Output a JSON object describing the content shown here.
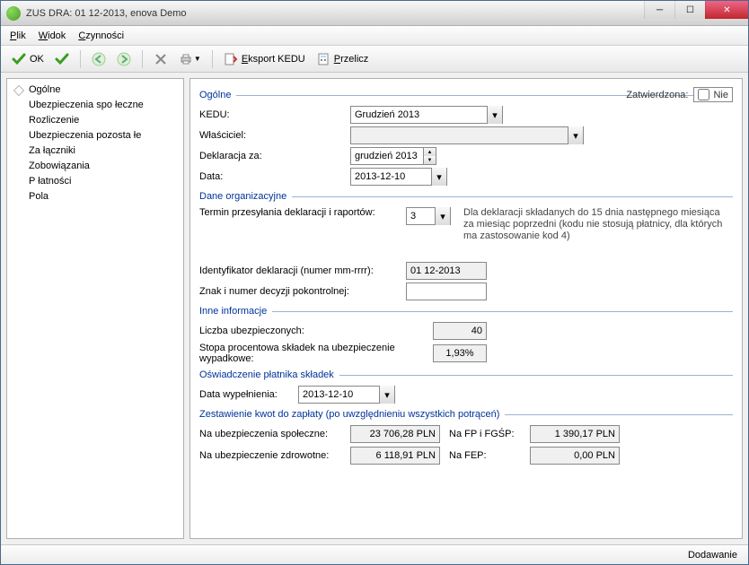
{
  "window": {
    "title": "ZUS DRA: 01 12-2013, enova Demo"
  },
  "menu": {
    "plik": "Plik",
    "widok": "Widok",
    "czynnosci": "Czynności"
  },
  "toolbar": {
    "ok": "OK",
    "eksport": "Eksport KEDU",
    "przelicz": "Przelicz"
  },
  "sidebar": {
    "items": [
      "Ogólne",
      "Ubezpieczenia spo łeczne",
      "Rozliczenie",
      "Ubezpieczenia pozosta łe",
      "Za łączniki",
      "Zobowiązania",
      "P łatności",
      "Pola"
    ]
  },
  "groups": {
    "ogolne": "Ogólne",
    "dane_org": "Dane organizacyjne",
    "inne": "Inne informacje",
    "oswiad": "Oświadczenie płatnika składek",
    "zest": "Zestawienie kwot do zapłaty (po uwzględnieniu wszystkich potrąceń)"
  },
  "labels": {
    "zatw": "Zatwierdzona:",
    "zatw_no": "Nie",
    "kedu": "KEDU:",
    "wlasciciel": "Właściciel:",
    "dekl_za": "Deklaracja za:",
    "data": "Data:",
    "termin": "Termin przesyłania deklaracji i raportów:",
    "termin_hint": "Dla deklaracji składanych do 15 dnia następnego miesiąca za miesiąc poprzedni (kodu nie stosują płatnicy, dla których ma zastosowanie kod 4)",
    "ident": "Identyfikator deklaracji (numer mm-rrrr):",
    "znak": "Znak i numer decyzji pokontrolnej:",
    "liczba": "Liczba ubezpieczonych:",
    "stopa": "Stopa procentowa składek na ubezpieczenie wypadkowe:",
    "data_wyp": "Data wypełnienia:",
    "na_spol": "Na ubezpieczenia społeczne:",
    "na_zdr": "Na ubezpieczenie zdrowotne:",
    "na_fp": "Na FP i FGŚP:",
    "na_fep": "Na FEP:"
  },
  "values": {
    "kedu": "Grudzień 2013",
    "wlasciciel": "",
    "dekl_za": "grudzień 2013",
    "data": "2013-12-10",
    "termin": "3",
    "ident": "01 12-2013",
    "znak": "",
    "liczba": "40",
    "stopa": "1,93%",
    "data_wyp": "2013-12-10",
    "na_spol": "23 706,28 PLN",
    "na_zdr": "6 118,91 PLN",
    "na_fp": "1 390,17 PLN",
    "na_fep": "0,00 PLN"
  },
  "status": {
    "text": "Dodawanie"
  }
}
